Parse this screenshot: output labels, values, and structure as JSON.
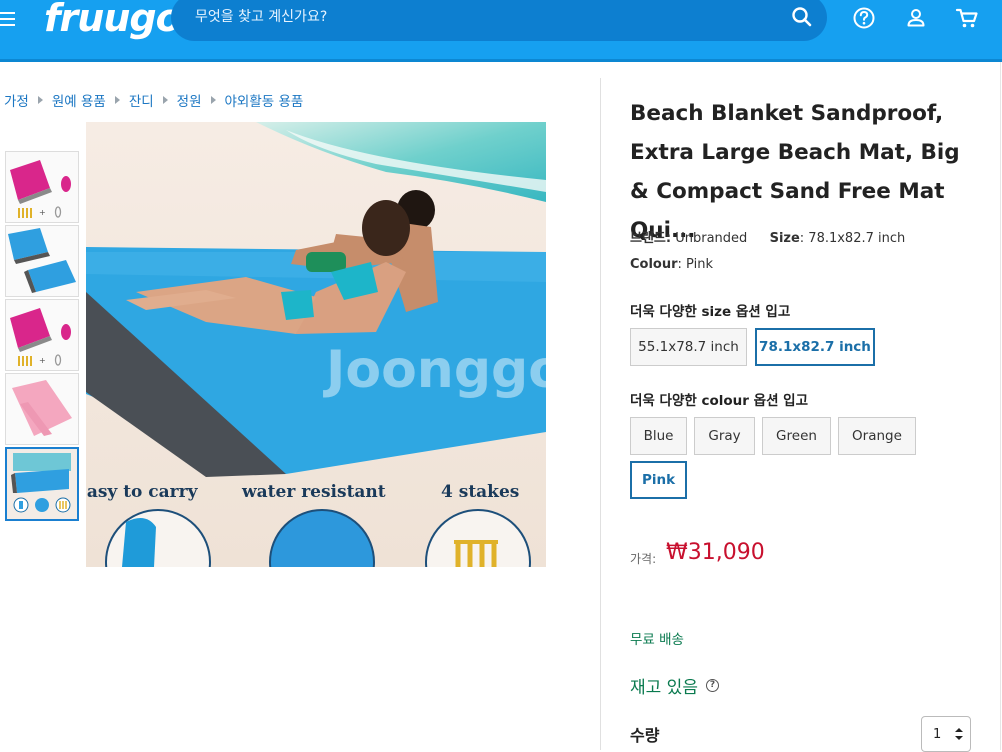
{
  "header": {
    "logo": "fruugo",
    "search_placeholder": "무엇을 찾고 계신가요?"
  },
  "breadcrumb": [
    "가정",
    "원예 용품",
    "잔디",
    "정원",
    "야외활동 용품"
  ],
  "main_image": {
    "captions": [
      "easy to carry",
      "water resistant",
      "4 stakes"
    ],
    "watermark": "Joonggo"
  },
  "product": {
    "title": "Beach Blanket Sandproof, Extra Large Beach Mat, Big & Compact Sand Free Mat Qui...",
    "brand_label": "브랜드:",
    "brand_value": "Unbranded",
    "size_label": "Size",
    "size_value": ": 78.1x82.7 inch",
    "colour_label": "Colour",
    "colour_value": ": Pink"
  },
  "size_options": {
    "heading": "더욱 다양한 size 옵션 입고",
    "options": [
      "55.1x78.7 inch",
      "78.1x82.7 inch"
    ],
    "selected": "78.1x82.7 inch"
  },
  "colour_options": {
    "heading": "더욱 다양한 colour 옵션 입고",
    "options": [
      "Blue",
      "Gray",
      "Green",
      "Orange",
      "Pink"
    ],
    "selected": "Pink"
  },
  "price": {
    "label": "가격:",
    "value": "₩31,090",
    "color": "#c8102e"
  },
  "shipping": "무료 배송",
  "stock": "재고 있음",
  "quantity": {
    "label": "수량",
    "value": "1"
  },
  "colors": {
    "header": "#16a0f0",
    "accent": "#1b6fa8",
    "success": "#0a7a4f"
  }
}
